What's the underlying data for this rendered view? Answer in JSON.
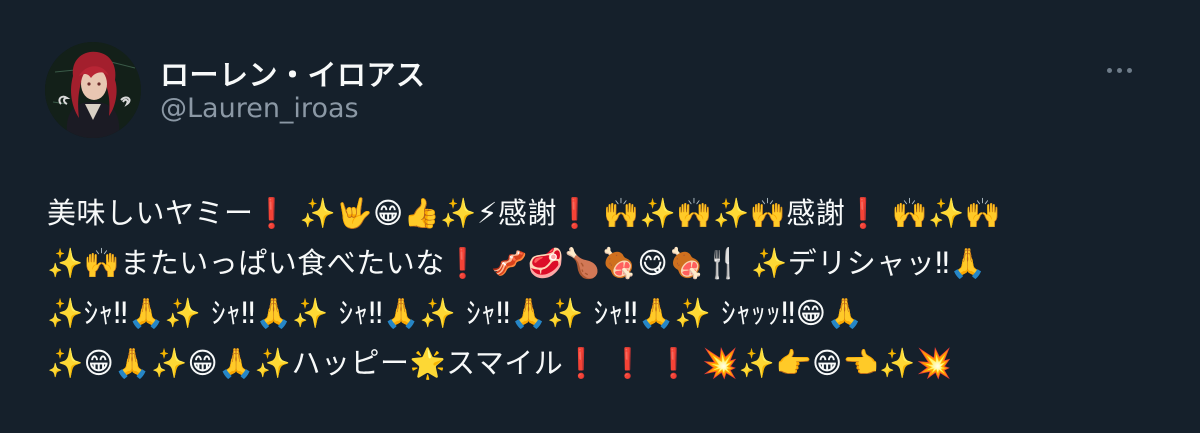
{
  "user": {
    "display_name": "ローレン・イロアス",
    "handle": "@Lauren_iroas",
    "avatar_icon": "profile-avatar"
  },
  "more_icon": "more-horizontal-icon",
  "colors": {
    "background": "#15202b",
    "text": "#f7f9f9",
    "secondary_text": "#8b98a5"
  },
  "tweet": {
    "lines": [
      "美味しいヤミー❗ ✨🤟😁👍✨⚡感謝❗ 🙌✨🙌✨🙌感謝❗ 🙌✨🙌",
      "✨🙌またいっぱい食べたいな❗ 🥓🥩🍗🍖😋🍖🍴 ✨デリシャッ‼🙏",
      "✨ｼｬ‼🙏✨ ｼｬ‼🙏✨ ｼｬ‼🙏✨ ｼｬ‼🙏✨ ｼｬ‼🙏✨ ｼｬｯｯ‼😁🙏",
      "✨😁🙏✨😁🙏✨ハッピー🌟スマイル❗ ❗ ❗ 💥✨👉😁👈✨💥"
    ]
  }
}
